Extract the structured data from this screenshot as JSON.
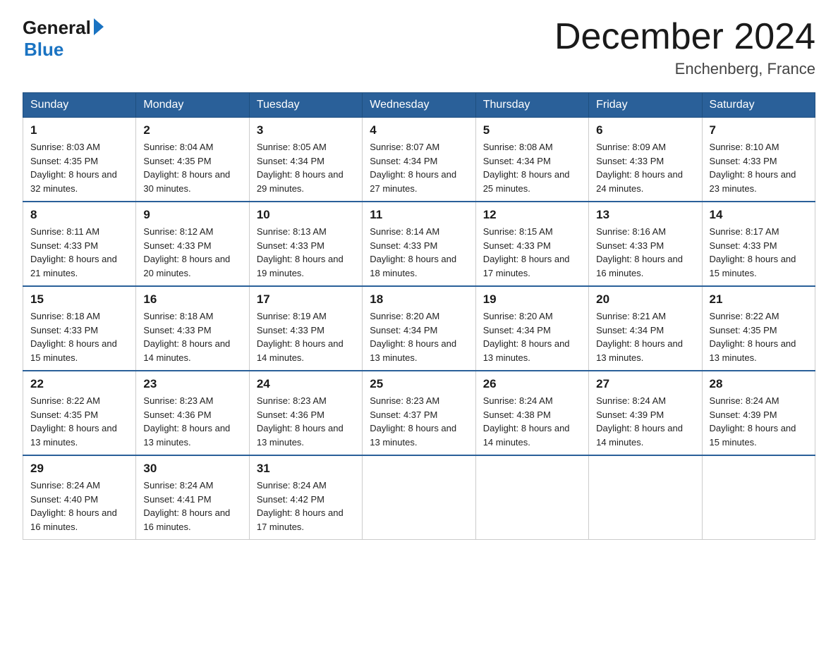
{
  "header": {
    "logo_general": "General",
    "logo_blue": "Blue",
    "title": "December 2024",
    "subtitle": "Enchenberg, France"
  },
  "days_of_week": [
    "Sunday",
    "Monday",
    "Tuesday",
    "Wednesday",
    "Thursday",
    "Friday",
    "Saturday"
  ],
  "weeks": [
    [
      {
        "day": "1",
        "sunrise": "8:03 AM",
        "sunset": "4:35 PM",
        "daylight": "8 hours and 32 minutes."
      },
      {
        "day": "2",
        "sunrise": "8:04 AM",
        "sunset": "4:35 PM",
        "daylight": "8 hours and 30 minutes."
      },
      {
        "day": "3",
        "sunrise": "8:05 AM",
        "sunset": "4:34 PM",
        "daylight": "8 hours and 29 minutes."
      },
      {
        "day": "4",
        "sunrise": "8:07 AM",
        "sunset": "4:34 PM",
        "daylight": "8 hours and 27 minutes."
      },
      {
        "day": "5",
        "sunrise": "8:08 AM",
        "sunset": "4:34 PM",
        "daylight": "8 hours and 25 minutes."
      },
      {
        "day": "6",
        "sunrise": "8:09 AM",
        "sunset": "4:33 PM",
        "daylight": "8 hours and 24 minutes."
      },
      {
        "day": "7",
        "sunrise": "8:10 AM",
        "sunset": "4:33 PM",
        "daylight": "8 hours and 23 minutes."
      }
    ],
    [
      {
        "day": "8",
        "sunrise": "8:11 AM",
        "sunset": "4:33 PM",
        "daylight": "8 hours and 21 minutes."
      },
      {
        "day": "9",
        "sunrise": "8:12 AM",
        "sunset": "4:33 PM",
        "daylight": "8 hours and 20 minutes."
      },
      {
        "day": "10",
        "sunrise": "8:13 AM",
        "sunset": "4:33 PM",
        "daylight": "8 hours and 19 minutes."
      },
      {
        "day": "11",
        "sunrise": "8:14 AM",
        "sunset": "4:33 PM",
        "daylight": "8 hours and 18 minutes."
      },
      {
        "day": "12",
        "sunrise": "8:15 AM",
        "sunset": "4:33 PM",
        "daylight": "8 hours and 17 minutes."
      },
      {
        "day": "13",
        "sunrise": "8:16 AM",
        "sunset": "4:33 PM",
        "daylight": "8 hours and 16 minutes."
      },
      {
        "day": "14",
        "sunrise": "8:17 AM",
        "sunset": "4:33 PM",
        "daylight": "8 hours and 15 minutes."
      }
    ],
    [
      {
        "day": "15",
        "sunrise": "8:18 AM",
        "sunset": "4:33 PM",
        "daylight": "8 hours and 15 minutes."
      },
      {
        "day": "16",
        "sunrise": "8:18 AM",
        "sunset": "4:33 PM",
        "daylight": "8 hours and 14 minutes."
      },
      {
        "day": "17",
        "sunrise": "8:19 AM",
        "sunset": "4:33 PM",
        "daylight": "8 hours and 14 minutes."
      },
      {
        "day": "18",
        "sunrise": "8:20 AM",
        "sunset": "4:34 PM",
        "daylight": "8 hours and 13 minutes."
      },
      {
        "day": "19",
        "sunrise": "8:20 AM",
        "sunset": "4:34 PM",
        "daylight": "8 hours and 13 minutes."
      },
      {
        "day": "20",
        "sunrise": "8:21 AM",
        "sunset": "4:34 PM",
        "daylight": "8 hours and 13 minutes."
      },
      {
        "day": "21",
        "sunrise": "8:22 AM",
        "sunset": "4:35 PM",
        "daylight": "8 hours and 13 minutes."
      }
    ],
    [
      {
        "day": "22",
        "sunrise": "8:22 AM",
        "sunset": "4:35 PM",
        "daylight": "8 hours and 13 minutes."
      },
      {
        "day": "23",
        "sunrise": "8:23 AM",
        "sunset": "4:36 PM",
        "daylight": "8 hours and 13 minutes."
      },
      {
        "day": "24",
        "sunrise": "8:23 AM",
        "sunset": "4:36 PM",
        "daylight": "8 hours and 13 minutes."
      },
      {
        "day": "25",
        "sunrise": "8:23 AM",
        "sunset": "4:37 PM",
        "daylight": "8 hours and 13 minutes."
      },
      {
        "day": "26",
        "sunrise": "8:24 AM",
        "sunset": "4:38 PM",
        "daylight": "8 hours and 14 minutes."
      },
      {
        "day": "27",
        "sunrise": "8:24 AM",
        "sunset": "4:39 PM",
        "daylight": "8 hours and 14 minutes."
      },
      {
        "day": "28",
        "sunrise": "8:24 AM",
        "sunset": "4:39 PM",
        "daylight": "8 hours and 15 minutes."
      }
    ],
    [
      {
        "day": "29",
        "sunrise": "8:24 AM",
        "sunset": "4:40 PM",
        "daylight": "8 hours and 16 minutes."
      },
      {
        "day": "30",
        "sunrise": "8:24 AM",
        "sunset": "4:41 PM",
        "daylight": "8 hours and 16 minutes."
      },
      {
        "day": "31",
        "sunrise": "8:24 AM",
        "sunset": "4:42 PM",
        "daylight": "8 hours and 17 minutes."
      },
      null,
      null,
      null,
      null
    ]
  ]
}
